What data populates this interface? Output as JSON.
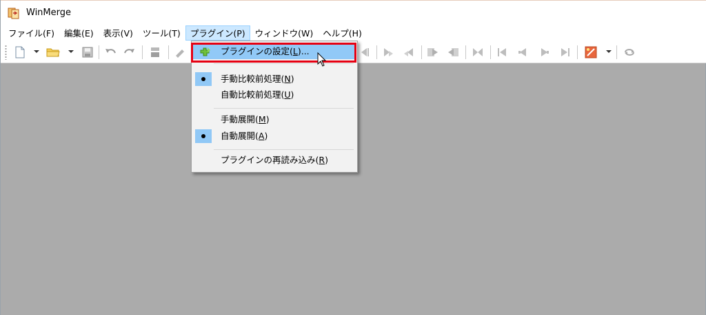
{
  "window": {
    "title": "WinMerge"
  },
  "menubar": {
    "items": [
      {
        "label": "ファイル(F)"
      },
      {
        "label": "編集(E)"
      },
      {
        "label": "表示(V)"
      },
      {
        "label": "ツール(T)"
      },
      {
        "label": "プラグイン(P)"
      },
      {
        "label": "ウィンドウ(W)"
      },
      {
        "label": "ヘルプ(H)"
      }
    ],
    "active_index": 4
  },
  "toolbar": {
    "icons": [
      "new-file-icon",
      "open-folder-icon",
      "save-icon",
      "undo-icon",
      "redo-icon",
      "merge-icon",
      "edit-icon",
      "next-diff-icon",
      "prev-diff-icon",
      "copy-left-icon",
      "copy-right-icon",
      "copy-all-icon",
      "first-diff-icon",
      "prev-icon",
      "next-icon",
      "last-diff-icon",
      "options-icon",
      "refresh-icon"
    ]
  },
  "plugin_menu": {
    "items": [
      {
        "label_prefix": "プラグインの設定(",
        "accel": "L",
        "label_suffix": ")...",
        "highlighted": true,
        "icon": "plugin-settings-icon"
      },
      {
        "label_prefix": "手動比較前処理(",
        "accel": "N",
        "label_suffix": ")",
        "checked": true
      },
      {
        "label_prefix": "自動比較前処理(",
        "accel": "U",
        "label_suffix": ")",
        "checked": false
      },
      {
        "label_prefix": "手動展開(",
        "accel": "M",
        "label_suffix": ")",
        "checked": false
      },
      {
        "label_prefix": "自動展開(",
        "accel": "A",
        "label_suffix": ")",
        "checked": true
      },
      {
        "label_prefix": "プラグインの再読み込み(",
        "accel": "R",
        "label_suffix": ")"
      }
    ]
  },
  "colors": {
    "highlight": "#91c9f7",
    "annotation_frame": "#e60012",
    "workspace": "#ababab"
  }
}
